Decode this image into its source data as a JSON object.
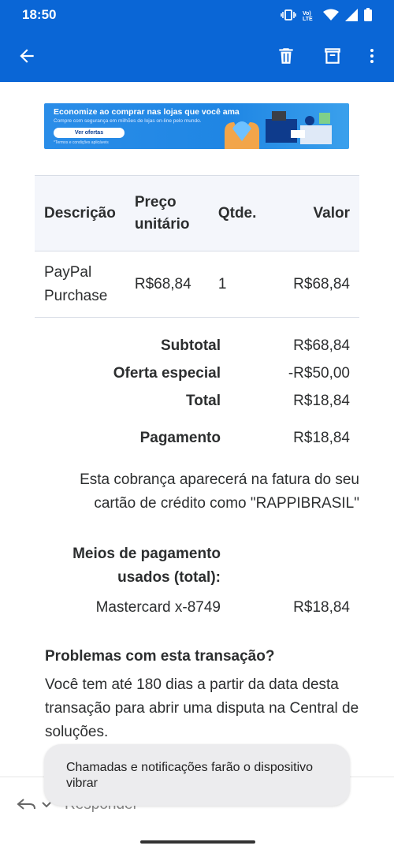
{
  "status_bar": {
    "time": "18:50",
    "network_label": "Vo) LTE"
  },
  "app_bar": {
    "back_icon": "arrow-left-icon",
    "delete_icon": "trash-icon",
    "archive_icon": "archive-icon",
    "menu_icon": "more-vert-icon"
  },
  "promo": {
    "title": "Economize ao comprar nas lojas que você ama",
    "subtitle": "Compre com segurança em milhões de lojas on-line pelo mundo.",
    "button": "Ver ofertas",
    "terms": "*Termos e condições aplicáveis"
  },
  "table": {
    "headers": {
      "description": "Descrição",
      "unit_price": "Preço unitário",
      "qty": "Qtde.",
      "value": "Valor"
    },
    "rows": [
      {
        "description": "PayPal Purchase",
        "unit_price": "R$68,84",
        "qty": "1",
        "value": "R$68,84"
      }
    ]
  },
  "summary": {
    "subtotal_label": "Subtotal",
    "subtotal": "R$68,84",
    "offer_label": "Oferta especial",
    "offer": "-R$50,00",
    "total_label": "Total",
    "total": "R$18,84",
    "payment_label": "Pagamento",
    "payment": "R$18,84"
  },
  "notice": "Esta cobrança aparecerá na fatura do seu cartão de crédito como \"RAPPIBRASIL\"",
  "methods": {
    "label": "Meios de pagamento usados (total):",
    "card": "Mastercard x-8749",
    "amount": "R$18,84"
  },
  "problems": {
    "title": "Problemas com esta transação?",
    "body": "Você tem até 180 dias a partir da data desta transação para abrir uma disputa na Central de soluções."
  },
  "toast": "Chamadas e notificações farão o dispositivo vibrar",
  "reply": {
    "label": "Responder"
  },
  "colors": {
    "app_blue": "#0a66d6",
    "text": "#2c2e2f",
    "table_header_bg": "#f4f6fb"
  }
}
